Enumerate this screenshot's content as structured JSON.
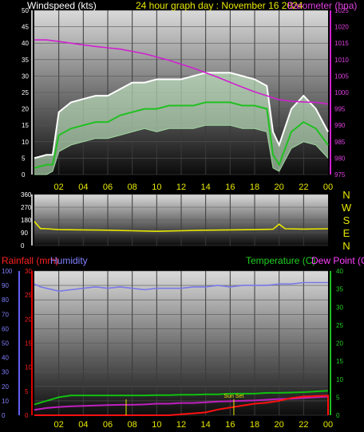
{
  "title": "24 hour graph day : November 16 2024",
  "colors": {
    "title": "#e8e800",
    "wind_label": "#ffffff",
    "baro_label": "#e040e0",
    "rain_label": "#ff2020",
    "hum_label": "#8080ff",
    "temp_label": "#20d020",
    "dew_label": "#ff40ff",
    "dir_letters": "#e8e800",
    "sunset": "#e8e800",
    "gust": "#ffffff",
    "avg": "#20c020",
    "wind_fill": "#c8f0c8",
    "baro": "#d020d0",
    "dir": "#e8e800",
    "hum": "#7878e8",
    "temp": "#10c010",
    "dew": "#c020c0",
    "rain": "#ff1010",
    "rain_axis": "#e00000",
    "hum_axis": "#6060f0",
    "temp_axis": "#20c020"
  },
  "chart_data": [
    {
      "type": "line",
      "name": "wind-baro",
      "ylabel": "Windspeed (kts)",
      "ylabel_right": "Barometer (hpa)",
      "ylim": [
        0,
        50
      ],
      "ylim_right": [
        975,
        1025
      ],
      "yticks": [
        0,
        5,
        10,
        15,
        20,
        25,
        30,
        35,
        40,
        45,
        50
      ],
      "yticks_right": [
        975,
        980,
        985,
        990,
        995,
        1000,
        1005,
        1010,
        1015,
        1020,
        1025
      ],
      "xlim": [
        0,
        24
      ],
      "xticks": [
        "02",
        "04",
        "06",
        "08",
        "10",
        "12",
        "14",
        "16",
        "18",
        "20",
        "22",
        "00"
      ],
      "gust_points": [
        [
          0,
          5
        ],
        [
          1,
          6
        ],
        [
          1.5,
          6
        ],
        [
          2,
          19
        ],
        [
          3,
          22
        ],
        [
          4,
          23
        ],
        [
          5,
          24
        ],
        [
          6,
          24
        ],
        [
          7,
          26
        ],
        [
          8,
          28
        ],
        [
          9,
          28
        ],
        [
          10,
          29
        ],
        [
          11,
          29
        ],
        [
          12,
          29
        ],
        [
          13,
          30
        ],
        [
          14,
          31
        ],
        [
          15,
          31
        ],
        [
          16,
          31
        ],
        [
          17,
          30
        ],
        [
          18,
          29
        ],
        [
          19,
          27
        ],
        [
          19.5,
          13
        ],
        [
          20,
          9
        ],
        [
          21,
          20
        ],
        [
          22,
          24
        ],
        [
          23,
          20
        ],
        [
          24,
          13
        ]
      ],
      "avg_points": [
        [
          0,
          2
        ],
        [
          1,
          3
        ],
        [
          1.5,
          3
        ],
        [
          2,
          12
        ],
        [
          3,
          14
        ],
        [
          4,
          15
        ],
        [
          5,
          16
        ],
        [
          6,
          16
        ],
        [
          7,
          18
        ],
        [
          8,
          19
        ],
        [
          9,
          20
        ],
        [
          10,
          20
        ],
        [
          11,
          21
        ],
        [
          12,
          21
        ],
        [
          13,
          21
        ],
        [
          14,
          22
        ],
        [
          15,
          22
        ],
        [
          16,
          22
        ],
        [
          17,
          21
        ],
        [
          18,
          21
        ],
        [
          19,
          20
        ],
        [
          19.5,
          6
        ],
        [
          20,
          3
        ],
        [
          21,
          13
        ],
        [
          22,
          16
        ],
        [
          23,
          14
        ],
        [
          24,
          9
        ]
      ],
      "lull_points": [
        [
          0,
          0
        ],
        [
          1,
          0
        ],
        [
          1.5,
          1
        ],
        [
          2,
          7
        ],
        [
          3,
          9
        ],
        [
          4,
          10
        ],
        [
          5,
          11
        ],
        [
          6,
          11
        ],
        [
          7,
          12
        ],
        [
          8,
          13
        ],
        [
          9,
          14
        ],
        [
          10,
          13
        ],
        [
          11,
          14
        ],
        [
          12,
          14
        ],
        [
          13,
          14
        ],
        [
          14,
          15
        ],
        [
          15,
          15
        ],
        [
          16,
          15
        ],
        [
          17,
          14
        ],
        [
          18,
          14
        ],
        [
          19,
          13
        ],
        [
          19.5,
          2
        ],
        [
          20,
          1
        ],
        [
          21,
          8
        ],
        [
          22,
          10
        ],
        [
          23,
          9
        ],
        [
          24,
          5
        ]
      ],
      "baro_points": [
        [
          0,
          1016
        ],
        [
          1,
          1016
        ],
        [
          2,
          1015.5
        ],
        [
          3,
          1015
        ],
        [
          4,
          1014.5
        ],
        [
          5,
          1014
        ],
        [
          6,
          1013.6
        ],
        [
          7,
          1013.2
        ],
        [
          8,
          1012.5
        ],
        [
          9,
          1011.8
        ],
        [
          10,
          1010.8
        ],
        [
          11,
          1009.8
        ],
        [
          12,
          1008.6
        ],
        [
          13,
          1007.4
        ],
        [
          14,
          1006
        ],
        [
          15,
          1004.6
        ],
        [
          16,
          1003.1
        ],
        [
          17,
          1001.6
        ],
        [
          18,
          1000.2
        ],
        [
          19,
          999
        ],
        [
          20,
          997.8
        ],
        [
          21,
          997.3
        ],
        [
          22,
          997.1
        ],
        [
          23,
          997
        ],
        [
          24,
          996.5
        ]
      ]
    },
    {
      "type": "line",
      "name": "wind-direction",
      "ylim": [
        0,
        360
      ],
      "yticks": [
        0,
        90,
        180,
        270,
        360
      ],
      "compass": [
        "N",
        "W",
        "S",
        "E",
        "N"
      ],
      "xlim": [
        0,
        24
      ],
      "dir_points": [
        [
          0,
          170
        ],
        [
          0.5,
          120
        ],
        [
          1,
          118
        ],
        [
          2,
          112
        ],
        [
          4,
          110
        ],
        [
          6,
          108
        ],
        [
          8,
          104
        ],
        [
          10,
          100
        ],
        [
          12,
          104
        ],
        [
          14,
          108
        ],
        [
          16,
          110
        ],
        [
          18,
          112
        ],
        [
          19.5,
          115
        ],
        [
          20,
          150
        ],
        [
          20.5,
          118
        ],
        [
          22,
          116
        ],
        [
          24,
          118
        ]
      ]
    },
    {
      "type": "line",
      "name": "rain-hum-temp",
      "ylabel": "Rainfall (mm)",
      "ylabel2": "Humidity",
      "ylabel_right": "Temperature (C)",
      "ylabel_right2": "Dew Point (C)",
      "ylim_rain": [
        0,
        30
      ],
      "ylim_hum": [
        0,
        100
      ],
      "ylim_temp": [
        0,
        40
      ],
      "yticks_rain": [
        0,
        5,
        10,
        15,
        20,
        25,
        30
      ],
      "yticks_hum": [
        0,
        10,
        20,
        30,
        40,
        50,
        60,
        70,
        80,
        90,
        100
      ],
      "yticks_temp": [
        0,
        5,
        10,
        15,
        20,
        25,
        30,
        35,
        40
      ],
      "xlim": [
        0,
        24
      ],
      "xticks": [
        "02",
        "04",
        "06",
        "08",
        "10",
        "12",
        "14",
        "16",
        "18",
        "20",
        "22",
        "00"
      ],
      "hum_points": [
        [
          0,
          91
        ],
        [
          0.5,
          89
        ],
        [
          1,
          88
        ],
        [
          2,
          86
        ],
        [
          3,
          87
        ],
        [
          4,
          88
        ],
        [
          5,
          89
        ],
        [
          6,
          88
        ],
        [
          7,
          89
        ],
        [
          8,
          88
        ],
        [
          9,
          87
        ],
        [
          10,
          88
        ],
        [
          11,
          88
        ],
        [
          12,
          88
        ],
        [
          13,
          89
        ],
        [
          14,
          89
        ],
        [
          15,
          90
        ],
        [
          16,
          89
        ],
        [
          17,
          90
        ],
        [
          18,
          90
        ],
        [
          19,
          90
        ],
        [
          20,
          91
        ],
        [
          21,
          91
        ],
        [
          22,
          92
        ],
        [
          23,
          92
        ],
        [
          24,
          92
        ]
      ],
      "temp_points": [
        [
          0,
          3
        ],
        [
          1,
          4
        ],
        [
          2,
          5
        ],
        [
          3,
          5.5
        ],
        [
          4,
          5.5
        ],
        [
          5,
          5.5
        ],
        [
          6,
          5.5
        ],
        [
          7,
          5.5
        ],
        [
          8,
          5.5
        ],
        [
          9,
          5.5
        ],
        [
          10,
          5.6
        ],
        [
          11,
          5.6
        ],
        [
          12,
          5.7
        ],
        [
          13,
          5.7
        ],
        [
          14,
          5.8
        ],
        [
          15,
          5.8
        ],
        [
          16,
          6
        ],
        [
          17,
          6
        ],
        [
          18,
          6
        ],
        [
          19,
          6.2
        ],
        [
          20,
          6.2
        ],
        [
          21,
          6.3
        ],
        [
          22,
          6.4
        ],
        [
          23,
          6.6
        ],
        [
          24,
          6.8
        ]
      ],
      "dew_points": [
        [
          0,
          1.5
        ],
        [
          1,
          2
        ],
        [
          2,
          2.3
        ],
        [
          3,
          2.5
        ],
        [
          4,
          2.6
        ],
        [
          5,
          2.7
        ],
        [
          6,
          2.8
        ],
        [
          7,
          2.9
        ],
        [
          8,
          2.9
        ],
        [
          9,
          3
        ],
        [
          10,
          3.2
        ],
        [
          11,
          3.2
        ],
        [
          12,
          3.4
        ],
        [
          13,
          3.4
        ],
        [
          14,
          3.6
        ],
        [
          15,
          3.8
        ],
        [
          16,
          3.9
        ],
        [
          17,
          4
        ],
        [
          18,
          4.1
        ],
        [
          19,
          4.3
        ],
        [
          20,
          4.5
        ],
        [
          21,
          4.6
        ],
        [
          22,
          4.8
        ],
        [
          23,
          5
        ],
        [
          24,
          5.2
        ]
      ],
      "rain_points": [
        [
          0,
          0
        ],
        [
          11,
          0
        ],
        [
          12,
          0.2
        ],
        [
          13,
          0.4
        ],
        [
          14,
          0.6
        ],
        [
          15,
          1.2
        ],
        [
          16,
          1.6
        ],
        [
          17,
          2
        ],
        [
          18,
          2.4
        ],
        [
          19,
          2.6
        ],
        [
          20,
          3
        ],
        [
          21,
          3.6
        ],
        [
          22,
          3.9
        ],
        [
          23,
          4
        ],
        [
          24,
          4.1
        ],
        [
          24,
          0
        ]
      ],
      "markers": [
        {
          "x": 7.5,
          "label": ""
        },
        {
          "x": 16.3,
          "label": "Sun Set"
        }
      ]
    }
  ]
}
